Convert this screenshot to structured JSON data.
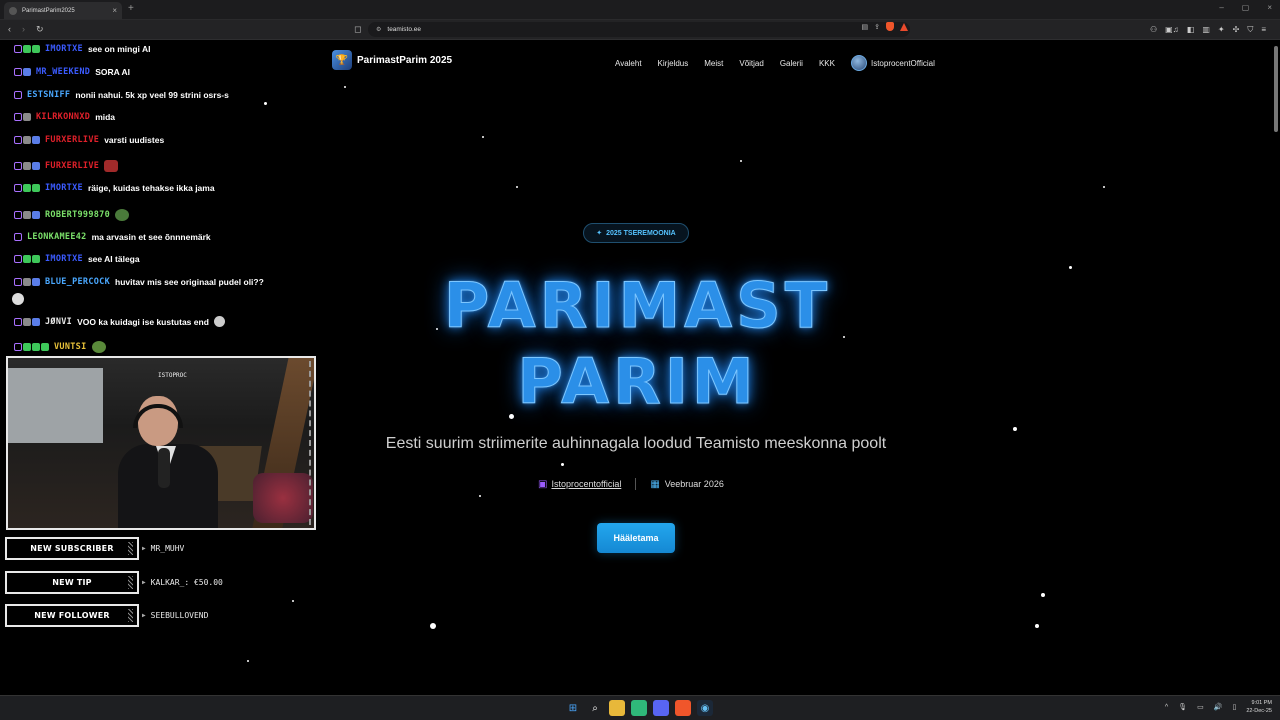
{
  "browser": {
    "tab_title": "ParimastParim2025",
    "tab_close": "×",
    "new_tab": "+",
    "url": "teamisto.ee",
    "window_controls": [
      "–",
      "▢",
      "×"
    ]
  },
  "site": {
    "brand": "ParimastParim 2025",
    "nav": [
      "Avaleht",
      "Kirjeldus",
      "Meist",
      "Võitjad",
      "Galerii",
      "KKK"
    ],
    "user": "IstoprocentOfficial",
    "pill": "2025 TSEREMOONIA",
    "hero_line1": "PARIMAST",
    "hero_line2": "PARIM",
    "subtitle": "Eesti suurim striimerite auhinnagala loodud Teamisto meeskonna poolt",
    "channel_link": "Istoprocentofficial",
    "date": "Veebruar 2026",
    "vote_button": "Hääletama"
  },
  "chat": [
    {
      "user": "IMORTXE",
      "color": "#3b5bff",
      "text": "see on mingi AI"
    },
    {
      "user": "MR_WEEKEND",
      "color": "#3b5bff",
      "text": "SORA AI"
    },
    {
      "user": "ESTSNIFF",
      "color": "#4aa8ff",
      "text": "nonii nahui. 5k xp veel 99 strini osrs-s"
    },
    {
      "user": "KILRKONNXD",
      "color": "#e0202a",
      "text": "mida"
    },
    {
      "user": "FURXERLIVE",
      "color": "#e0202a",
      "text": "varsti uudistes"
    },
    {
      "user": "FURXERLIVE",
      "color": "#e0202a",
      "text": ""
    },
    {
      "user": "IMORTXE",
      "color": "#3b5bff",
      "text": "räige, kuidas tehakse ikka jama"
    },
    {
      "user": "ROBERT999870",
      "color": "#7be06a",
      "text": ""
    },
    {
      "user": "LEONKAMEE42",
      "color": "#7be06a",
      "text": "ma arvasin et see õnnnemärk"
    },
    {
      "user": "IMORTXE",
      "color": "#3b5bff",
      "text": "see AI tälega"
    },
    {
      "user": "BLUE_PERCOCK",
      "color": "#4aa8ff",
      "text": "huvitav mis see originaal pudel oli??"
    },
    {
      "user": "JØNVI",
      "color": "#e8e8e8",
      "text": "VOO ka kuidagi ise kustutas end"
    },
    {
      "user": "VUNTSI",
      "color": "#e8c23a",
      "text": ""
    }
  ],
  "webcam": {
    "label": "ISTOPROC"
  },
  "alerts": [
    {
      "label": "NEW SUBSCRIBER",
      "value": "MR_MUHV"
    },
    {
      "label": "NEW TIP",
      "value": "KALKAR_: €50.00"
    },
    {
      "label": "NEW FOLLOWER",
      "value": "SEEBULLOVEND"
    }
  ],
  "taskbar": {
    "time": "9:01 PM",
    "date": "22-Dec-25"
  },
  "colors": {
    "accent": "#23a7ee",
    "hero_blue": "#2b8fe8",
    "twitch": "#9b5cff"
  }
}
